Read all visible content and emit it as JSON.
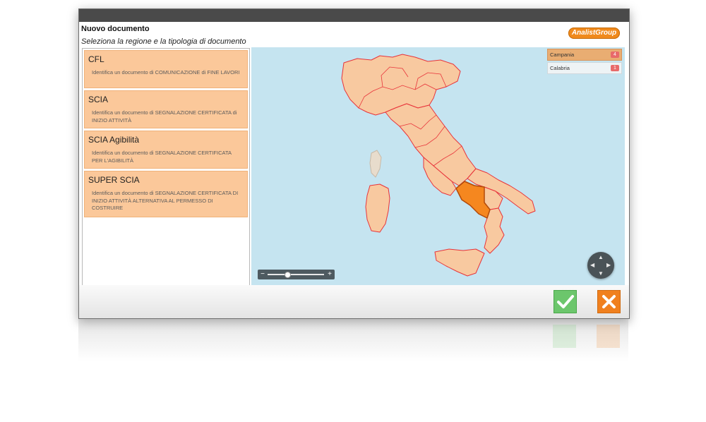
{
  "window": {
    "title": "Nuovo documento",
    "subtitle": "Seleziona la regione e la tipologia di documento",
    "logo": "AnalistGroup"
  },
  "documents": [
    {
      "name": "CFL",
      "description": "Identifica un documento di COMUNICAZIONE di FINE LAVORI"
    },
    {
      "name": "SCIA",
      "description": "Identifica un documento di SEGNALAZIONE CERTIFICATA di INIZIO ATTIVITÀ"
    },
    {
      "name": "SCIA Agibilità",
      "description": "Identifica un documento di SEGNALAZIONE CERTIFICATA PER L'AGIBILITÀ"
    },
    {
      "name": "SUPER SCIA",
      "description": "Identifica un documento di SEGNALAZIONE CERTIFICATA DI INIZIO ATTIVITÀ ALTERNATIVA AL PERMESSO DI COSTRUIRE"
    }
  ],
  "regions": [
    {
      "name": "Campania",
      "count": "4",
      "selected": true
    },
    {
      "name": "Calabria",
      "count": "1",
      "selected": false
    }
  ],
  "map": {
    "zoom_minus": "−",
    "zoom_plus": "+",
    "zoom_level": 0.35,
    "land_color": "#f8c9a0",
    "border_color": "#e8333a",
    "selected_color": "#f5871f",
    "sea_color": "#c5e4f0"
  },
  "footer": {
    "ok_icon": "check-icon",
    "cancel_icon": "x-icon"
  }
}
